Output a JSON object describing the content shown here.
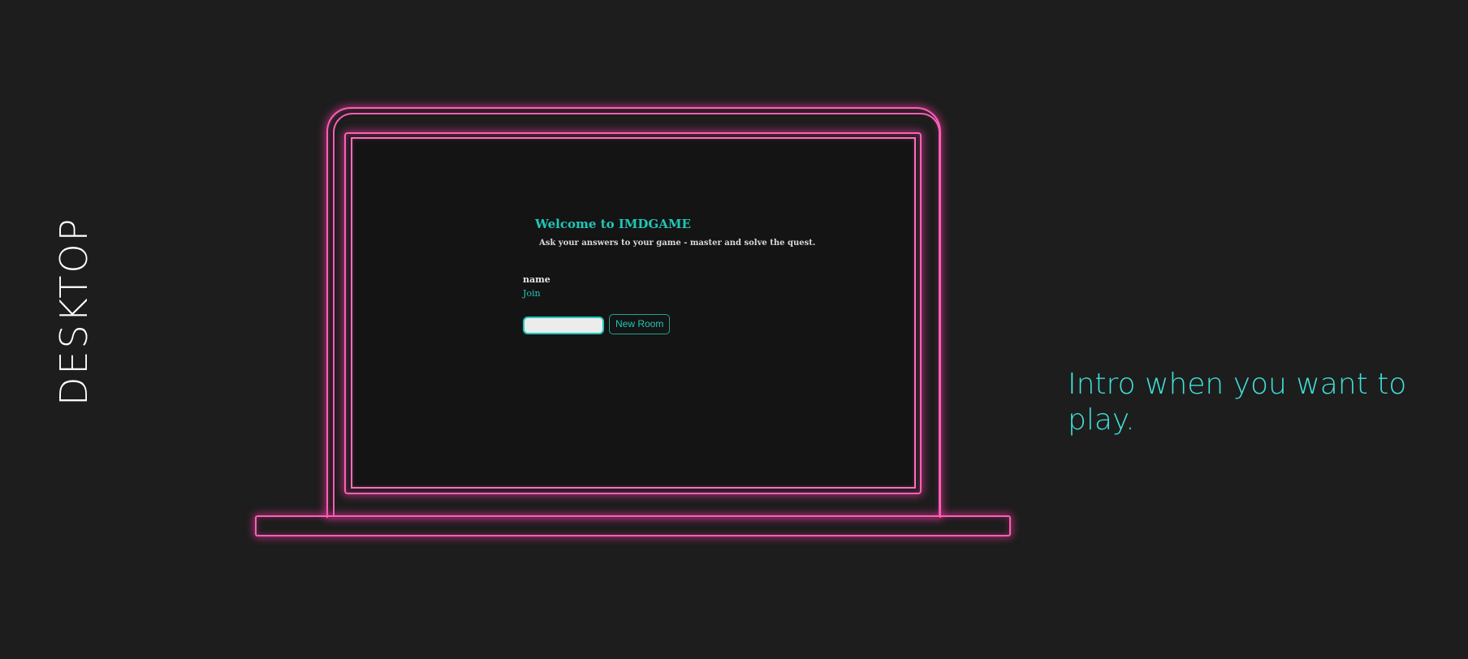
{
  "side_label": "DESKTOP",
  "caption": "Intro when you want to play.",
  "colors": {
    "background": "#1d1d1d",
    "neon_pink": "#ff5fb7",
    "accent_teal": "#1fc7b8",
    "caption_cyan": "#3fe0d8"
  },
  "app": {
    "title": "Welcome to IMDGAME",
    "subtitle": "Ask your answers to your game - master and solve the quest.",
    "name_label": "name",
    "join_label": "Join",
    "room_input_value": "",
    "new_room_label": "New Room"
  }
}
